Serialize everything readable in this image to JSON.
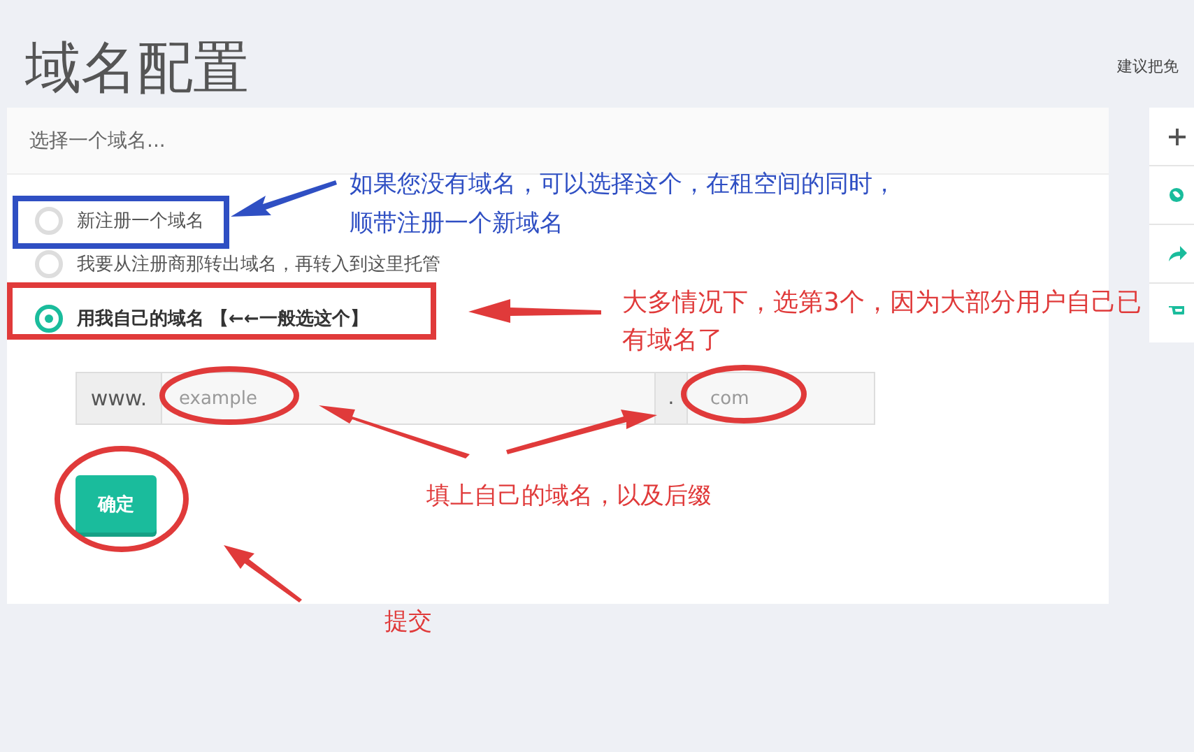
{
  "page_title": "域名配置",
  "side_note": "建议把免",
  "domain_select": {
    "placeholder": "选择一个域名..."
  },
  "options": [
    {
      "label": "新注册一个域名",
      "selected": false
    },
    {
      "label": "我要从注册商那转出域名，再转入到这里托管",
      "selected": false
    },
    {
      "label": "用我自己的域名 【←←一般选这个】",
      "selected": true
    }
  ],
  "domain_input": {
    "prefix": "www.",
    "name_placeholder": "example",
    "separator": ".",
    "suffix_placeholder": "com"
  },
  "submit_button": "确定",
  "annotations": [
    {
      "text": "如果您没有域名，可以选择这个，在租空间的同时，顺带注册一个新域名",
      "color": "#2f4fc3"
    },
    {
      "text": "大多情况下，选第3个，因为大部分用户自己已有域名了",
      "color": "#e03a3a"
    },
    {
      "text": "填上自己的域名，以及后缀",
      "color": "#e03a3a"
    },
    {
      "text": "提交",
      "color": "#e03a3a"
    }
  ]
}
